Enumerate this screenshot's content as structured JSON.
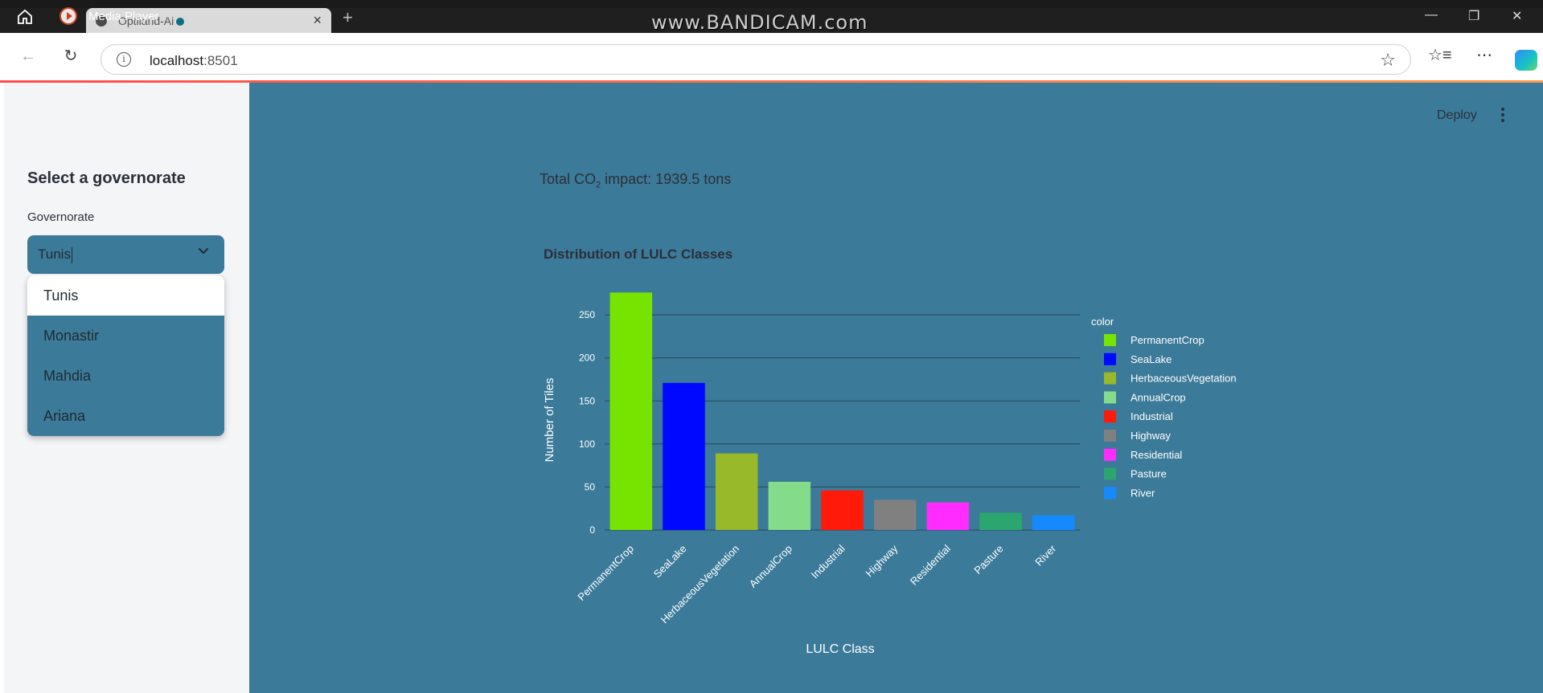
{
  "window": {
    "player_label": "Media Player",
    "tab_title": "Optiland-Ai",
    "tab_close": "×",
    "new_tab": "+",
    "watermark": "www.BANDICAM.com",
    "minimize": "—",
    "restore": "❐",
    "close": "✕"
  },
  "address_bar": {
    "host": "localhost",
    "port": ":8501",
    "info_icon": "i",
    "star_icon": "☆",
    "back_icon": "←",
    "reload_icon": "↻",
    "favorites_icon": "☆≡",
    "more_icon": "⋯"
  },
  "app": {
    "deploy_label": "Deploy",
    "total_prefix": "Total CO",
    "total_sub": "2",
    "total_suffix": " impact: 1939.5 tons"
  },
  "sidebar": {
    "heading": "Select a governorate",
    "field_label": "Governorate",
    "selected_value": "Tunis",
    "options": [
      "Tunis",
      "Monastir",
      "Mahdia",
      "Ariana"
    ]
  },
  "chart_data": {
    "type": "bar",
    "title": "Distribution of LULC Classes",
    "xlabel": "LULC Class",
    "ylabel": "Number of Tiles",
    "legend_title": "color",
    "legend_position": "right",
    "ylim": [
      0,
      280
    ],
    "yticks": [
      0,
      50,
      100,
      150,
      200,
      250
    ],
    "grid": true,
    "categories": [
      "PermanentCrop",
      "SeaLake",
      "HerbaceousVegetation",
      "AnnualCrop",
      "Industrial",
      "Highway",
      "Residential",
      "Pasture",
      "River"
    ],
    "values": [
      276,
      171,
      89,
      56,
      46,
      35,
      32,
      20,
      17
    ],
    "colors": [
      "#77e400",
      "#0008ff",
      "#97b92a",
      "#84dc8b",
      "#ff1a0a",
      "#808080",
      "#ff2bff",
      "#2ba66e",
      "#158aff"
    ]
  }
}
